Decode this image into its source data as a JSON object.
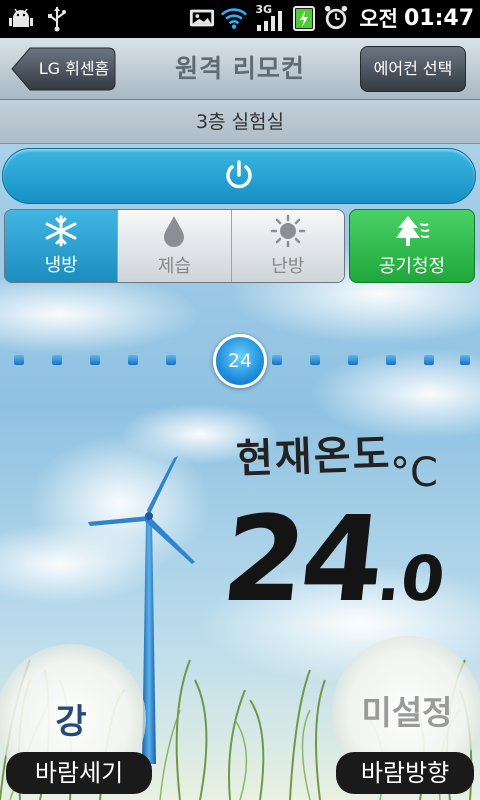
{
  "status_bar": {
    "ampm": "오전",
    "time": "01:47",
    "network": "3G"
  },
  "header": {
    "back_label": "LG 휘센홈",
    "title": "원격 리모컨",
    "select_label": "에어컨 선택"
  },
  "room": "3층 실험실",
  "modes": [
    {
      "label": "냉방",
      "icon": "snowflake-icon",
      "active": true
    },
    {
      "label": "제습",
      "icon": "droplet-icon",
      "active": false
    },
    {
      "label": "난방",
      "icon": "sun-icon",
      "active": false
    }
  ],
  "air_clean": {
    "label": "공기청정",
    "icon": "tree-icon"
  },
  "temperature": {
    "set_value": "24",
    "current_label": "현재온도",
    "current_value_int": "24",
    "current_value_dec": ".0",
    "unit": "°C"
  },
  "wind_power": {
    "value": "강",
    "label": "바람세기"
  },
  "wind_direction": {
    "value": "미설정",
    "label": "바람방향"
  },
  "colors": {
    "accent": "#1a8dbf",
    "air_clean": "#1fa73c"
  }
}
